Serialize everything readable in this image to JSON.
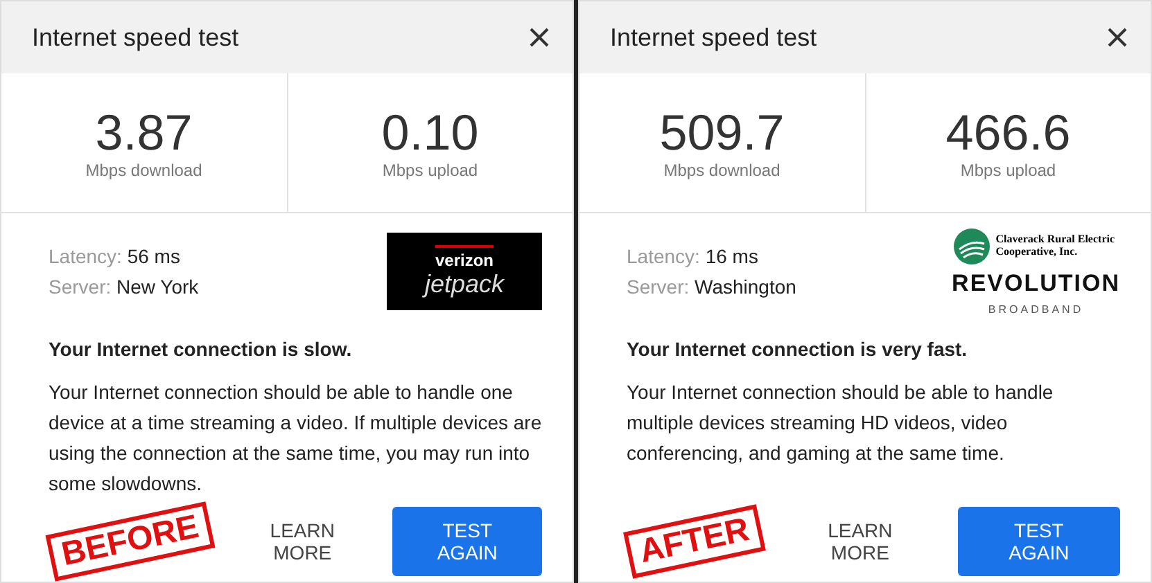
{
  "panels": [
    {
      "title": "Internet speed test",
      "metrics": [
        {
          "value": "3.87",
          "label": "Mbps download"
        },
        {
          "value": "0.10",
          "label": "Mbps upload"
        }
      ],
      "latency_label": "Latency:",
      "latency": "56 ms",
      "server_label": "Server:",
      "server": "New York",
      "logo": {
        "kind": "jetpack",
        "texts": [
          "verizon",
          "jetpack"
        ]
      },
      "status": "Your Internet connection is slow.",
      "message": "Your Internet connection should be able to handle one device at a time streaming a video. If multiple devices are using the connection at the same time, you may run into some slowdowns.",
      "buttons": [
        {
          "label": "LEARN MORE",
          "kind": "text"
        },
        {
          "label": "TEST AGAIN",
          "kind": "primary"
        }
      ],
      "stamp": "BEFORE"
    },
    {
      "title": "Internet speed test",
      "metrics": [
        {
          "value": "509.7",
          "label": "Mbps download"
        },
        {
          "value": "466.6",
          "label": "Mbps upload"
        }
      ],
      "latency_label": "Latency:",
      "latency": "16 ms",
      "server_label": "Server:",
      "server": "Washington",
      "logo": {
        "kind": "coop",
        "texts": [
          "Claverack Rural Electric Cooperative, Inc.",
          "REVOLUTION",
          "BROADBAND"
        ]
      },
      "status": "Your Internet connection is very fast.",
      "message": "Your Internet connection should be able to handle multiple devices streaming HD videos, video conferencing, and gaming at the same time.",
      "buttons": [
        {
          "label": "LEARN MORE",
          "kind": "text"
        },
        {
          "label": "TEST AGAIN",
          "kind": "primary"
        }
      ],
      "stamp": "AFTER"
    }
  ]
}
